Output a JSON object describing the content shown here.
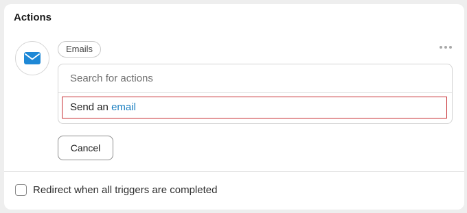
{
  "section": {
    "title": "Actions"
  },
  "action": {
    "icon": "envelope-icon",
    "category_chip": "Emails",
    "search": {
      "placeholder": "Search for actions",
      "value": ""
    },
    "options": [
      {
        "prefix": "Send an ",
        "highlight": "email"
      }
    ],
    "cancel_label": "Cancel"
  },
  "redirect": {
    "label": "Redirect when all triggers are completed",
    "checked": false
  },
  "colors": {
    "accent": "#1a7fc1",
    "selection_border": "#c62a2f",
    "icon_blue": "#1e88d6"
  }
}
